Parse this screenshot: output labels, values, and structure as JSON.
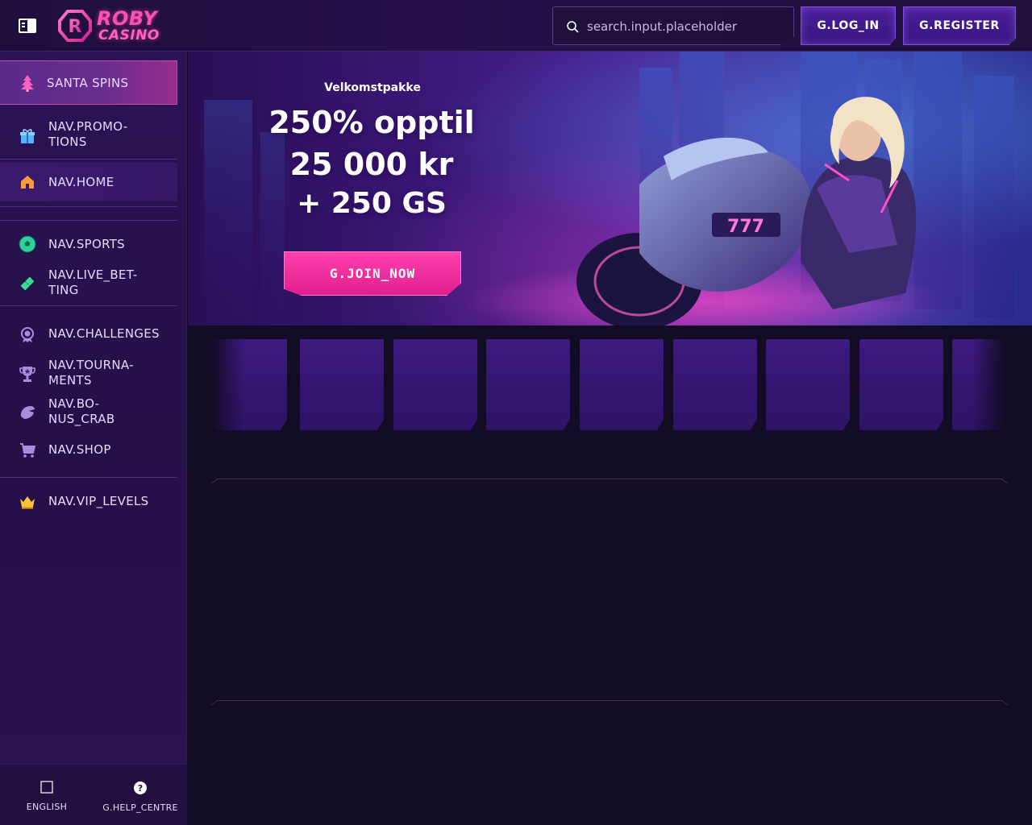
{
  "brand": {
    "line1": "ROBY",
    "line2": "CASINO",
    "accent_color": "#ff4fb0"
  },
  "header": {
    "search_placeholder": "search.input.placeholder",
    "login_label": "G.LOG_IN",
    "register_label": "G.REGISTER"
  },
  "sidebar": {
    "items": [
      {
        "label": "SANTA SPINS",
        "icon": "christmas-tree-icon"
      },
      {
        "label": "NAV.PROMO-\nTIONS",
        "icon": "gift-icon"
      },
      {
        "label": "NAV.HOME",
        "icon": "home-icon"
      },
      {
        "label": "NAV.SPORTS",
        "icon": "soccer-ball-icon"
      },
      {
        "label": "NAV.LIVE_BET-\nTING",
        "icon": "ticket-icon"
      },
      {
        "label": "NAV.CHALLENGES",
        "icon": "medal-icon"
      },
      {
        "label": "NAV.TOURNA-\nMENTS",
        "icon": "trophy-icon"
      },
      {
        "label": "NAV.BO-\nNUS_CRAB",
        "icon": "crab-claw-icon"
      },
      {
        "label": "NAV.SHOP",
        "icon": "cart-icon"
      },
      {
        "label": "NAV.VIP_LEVELS",
        "icon": "crown-icon"
      }
    ],
    "footer": {
      "language_label": "ENGLISH",
      "help_label": "G.HELP_CENTRE"
    }
  },
  "banner": {
    "subtitle": "Velkomstpakke",
    "line1": "250% opptil",
    "line2": "25 000 kr",
    "line3": "+ 250 GS",
    "cta_label": "G.JOIN_NOW",
    "cta_color": "#ff3fae"
  }
}
